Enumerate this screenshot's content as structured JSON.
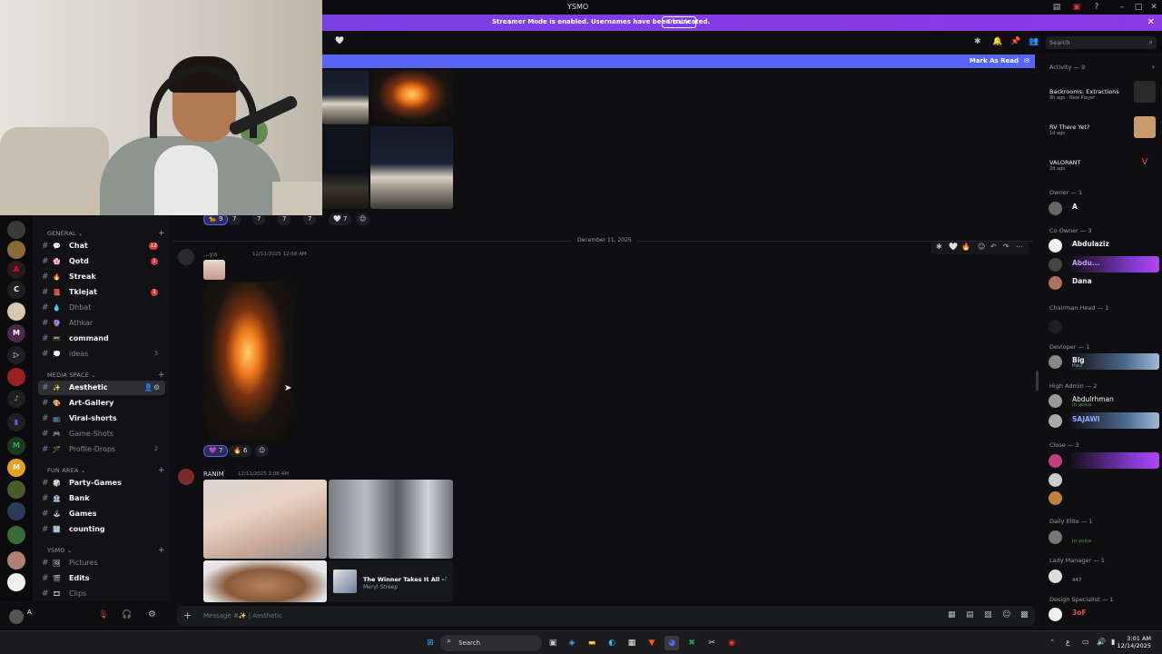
{
  "window": {
    "title": "YSMO"
  },
  "streamer_banner": {
    "text": "Streamer Mode is enabled. Usernames have been truncated.",
    "disable_label": "Disable"
  },
  "toolbar": {
    "search_placeholder": "Search"
  },
  "mark_as_read": {
    "label": "Mark As Read"
  },
  "channels": {
    "categories": [
      {
        "label": "GENERAL",
        "items": [
          {
            "emoji": "💬",
            "name": "Chat",
            "badge": "12",
            "style": "bright"
          },
          {
            "emoji": "🌸",
            "name": "Qotd",
            "badge": "1",
            "style": "bright"
          },
          {
            "emoji": "🔥",
            "name": "Streak",
            "badge": "",
            "style": "bright"
          },
          {
            "emoji": "📕",
            "name": "Tklejat",
            "badge": "1",
            "style": "bright"
          },
          {
            "emoji": "💧",
            "name": "Dhbat",
            "badge": "",
            "style": "dim"
          },
          {
            "emoji": "🔮",
            "name": "Athkar",
            "badge": "",
            "style": "dim"
          },
          {
            "emoji": "📟",
            "name": "command",
            "badge": "",
            "style": "bright"
          },
          {
            "emoji": "💭",
            "name": "ideas",
            "badge": "",
            "count": "3",
            "style": "dim"
          }
        ]
      },
      {
        "label": "MEDIA SPACE",
        "items": [
          {
            "emoji": "✨",
            "name": "Aesthetic",
            "badge": "",
            "style": "active"
          },
          {
            "emoji": "🎨",
            "name": "Art-Gallery",
            "badge": "",
            "style": "bright"
          },
          {
            "emoji": "📺",
            "name": "Viral-shorts",
            "badge": "",
            "style": "bright"
          },
          {
            "emoji": "🎮",
            "name": "Game-Shots",
            "badge": "",
            "style": "dim"
          },
          {
            "emoji": "🪄",
            "name": "Profile-Drops",
            "badge": "",
            "count": "2",
            "style": "dim"
          }
        ]
      },
      {
        "label": "FUN AREA",
        "items": [
          {
            "emoji": "🎲",
            "name": "Party-Games",
            "badge": "",
            "style": "bright"
          },
          {
            "emoji": "🏦",
            "name": "Bank",
            "badge": "",
            "style": "bright"
          },
          {
            "emoji": "🕹",
            "name": "Games",
            "badge": "",
            "style": "bright"
          },
          {
            "emoji": "🔢",
            "name": "counting",
            "badge": "",
            "style": "bright"
          }
        ]
      },
      {
        "label": "YSMO",
        "items": [
          {
            "emoji": "🖼",
            "name": "Pictures",
            "badge": "",
            "style": "dim"
          },
          {
            "emoji": "🎬",
            "name": "Edits",
            "badge": "",
            "style": "bright"
          },
          {
            "emoji": "🎞",
            "name": "Clips",
            "badge": "",
            "style": "dim"
          }
        ]
      }
    ]
  },
  "user_panel": {
    "name": "A"
  },
  "messages": {
    "top_reactions": [
      "🐆 9",
      "7",
      "7",
      "7",
      "7",
      "🤍 7"
    ],
    "date_divider": "December 11, 2025",
    "msg1": {
      "author": "...ya",
      "time": "12/11/2025 12:08 AM",
      "reactions": [
        "💜 7",
        "🔥 6"
      ]
    },
    "msg2": {
      "author": "RANIM",
      "time": "12/11/2025 2:08 AM"
    },
    "music_card": {
      "title": "The Winner Takes It All -",
      "artist": "Meryl Streep"
    }
  },
  "composer": {
    "placeholder": "Message #✨ | Aesthetic"
  },
  "members": {
    "activity_header": "Activity — 9",
    "activities": [
      {
        "name": "Backrooms: Extractions",
        "status": "9h ago · New Player",
        "thumb": "#2a2a2a"
      },
      {
        "name": "RV There Yet?",
        "status": "1d ago",
        "thumb": "#c99a6b"
      },
      {
        "name": "VALORANT",
        "status": "2d ago",
        "thumb": "#0f0f12"
      }
    ],
    "groups": [
      {
        "label": "Owner — 1",
        "members": [
          {
            "name": "A",
            "status": "",
            "style": ""
          }
        ]
      },
      {
        "label": "Co Owner — 3",
        "members": [
          {
            "name": "Abdulaziz",
            "status": "",
            "style": ""
          },
          {
            "name": "Abdu...",
            "status": "",
            "style": "fancy"
          },
          {
            "name": "Dana",
            "status": "",
            "style": ""
          }
        ]
      },
      {
        "label": "Chairman Head — 1",
        "members": [
          {
            "name": "",
            "status": "",
            "style": ""
          }
        ]
      },
      {
        "label": "Devloper — 1",
        "members": [
          {
            "name": "Big",
            "status": "Pie2",
            "style": "ice"
          }
        ]
      },
      {
        "label": "High Admin — 2",
        "members": [
          {
            "name": "Abdulrhman",
            "status": "In voice",
            "style": ""
          },
          {
            "name": "SAJAWI",
            "status": "",
            "style": "ice"
          }
        ]
      },
      {
        "label": "Close — 3",
        "members": [
          {
            "name": "",
            "status": "",
            "style": "fancy"
          },
          {
            "name": "",
            "status": "",
            "style": ""
          },
          {
            "name": "",
            "status": "",
            "style": ""
          }
        ]
      },
      {
        "label": "Daily Elite — 1",
        "members": [
          {
            "name": "",
            "status": "In voice",
            "style": ""
          }
        ]
      },
      {
        "label": "Lady Manager — 1",
        "members": [
          {
            "name": "",
            "status": "447",
            "style": ""
          }
        ]
      },
      {
        "label": "Design Specialist — 1",
        "members": [
          {
            "name": "3oF",
            "status": "",
            "style": ""
          }
        ]
      }
    ]
  },
  "taskbar": {
    "search_label": "Search",
    "time": "3:01 AM",
    "date": "12/14/2025"
  }
}
